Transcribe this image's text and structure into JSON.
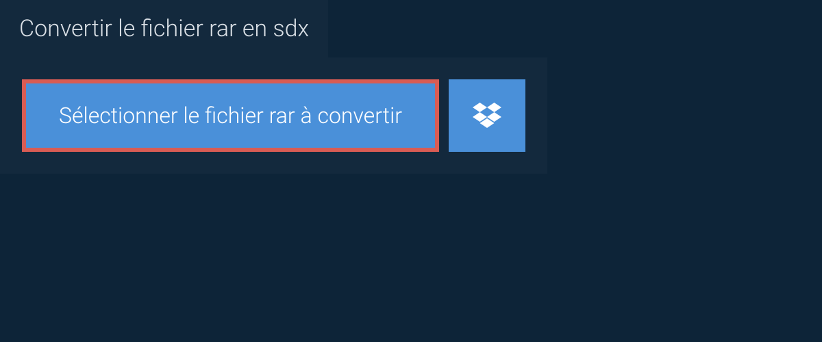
{
  "header": {
    "title": "Convertir le fichier rar en sdx"
  },
  "actions": {
    "select_file_label": "Sélectionner le fichier rar à convertir"
  },
  "colors": {
    "background": "#0d2438",
    "panel": "#13293d",
    "button": "#4a90d9",
    "highlight_border": "#d95c54",
    "text_light": "#d9dfe5",
    "text_white": "#ffffff"
  }
}
